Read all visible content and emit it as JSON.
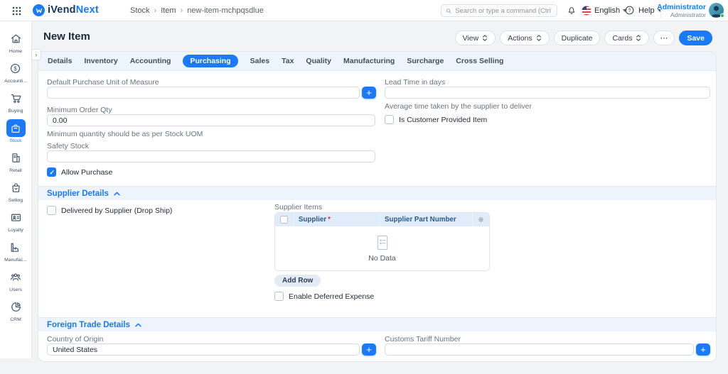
{
  "brand": {
    "name_primary": "iVend",
    "name_accent": "Next"
  },
  "navbar": {
    "breadcrumb": [
      {
        "label": "Stock"
      },
      {
        "label": "Item"
      },
      {
        "label": "new-item-mchpqsdlue"
      }
    ],
    "separator": "›",
    "search_placeholder": "Search or type a command (Ctrl + G)",
    "language": "English",
    "help_label": "Help",
    "user_name": "Administrator",
    "user_role": "Administrator"
  },
  "sidebar": {
    "items": [
      {
        "label": "Home",
        "active": false
      },
      {
        "label": "Accounti...",
        "active": false
      },
      {
        "label": "Buying",
        "active": false
      },
      {
        "label": "Stock",
        "active": true
      },
      {
        "label": "Retail",
        "active": false
      },
      {
        "label": "Selling",
        "active": false
      },
      {
        "label": "Loyalty",
        "active": false
      },
      {
        "label": "Manufac...",
        "active": false
      },
      {
        "label": "Users",
        "active": false
      },
      {
        "label": "CRM",
        "active": false
      }
    ]
  },
  "page": {
    "title": "New Item"
  },
  "toolbar": {
    "view": "View",
    "actions": "Actions",
    "duplicate": "Duplicate",
    "cards": "Cards",
    "more": "⋯",
    "save": "Save"
  },
  "icons": {
    "plus": "+",
    "expand": "›"
  },
  "tabs": [
    {
      "label": "Details",
      "active": false
    },
    {
      "label": "Inventory",
      "active": false
    },
    {
      "label": "Accounting",
      "active": false
    },
    {
      "label": "Purchasing",
      "active": true
    },
    {
      "label": "Sales",
      "active": false
    },
    {
      "label": "Tax",
      "active": false
    },
    {
      "label": "Quality",
      "active": false
    },
    {
      "label": "Manufacturing",
      "active": false
    },
    {
      "label": "Surcharge",
      "active": false
    },
    {
      "label": "Cross Selling",
      "active": false
    }
  ],
  "purchasing": {
    "default_purchase_uom": {
      "label": "Default Purchase Unit of Measure",
      "value": ""
    },
    "lead_time": {
      "label": "Lead Time in days",
      "value": "",
      "help": "Average time taken by the supplier to deliver"
    },
    "min_order_qty": {
      "label": "Minimum Order Qty",
      "value": "0.00",
      "help": "Minimum quantity should be as per Stock UOM"
    },
    "is_customer_provided": {
      "label": "Is Customer Provided Item",
      "checked": false
    },
    "safety_stock": {
      "label": "Safety Stock",
      "value": ""
    },
    "allow_purchase": {
      "label": "Allow Purchase",
      "checked": true
    }
  },
  "supplier_details": {
    "title": "Supplier Details",
    "drop_ship": {
      "label": "Delivered by Supplier (Drop Ship)",
      "checked": false
    },
    "supplier_items": {
      "label": "Supplier Items",
      "columns": [
        {
          "label": "Supplier",
          "required": true
        },
        {
          "label": "Supplier Part Number",
          "required": false
        }
      ],
      "required_marker": "*",
      "empty_text": "No Data",
      "add_row_label": "Add Row"
    },
    "deferred_expense": {
      "label": "Enable Deferred Expense",
      "checked": false
    }
  },
  "foreign_trade": {
    "title": "Foreign Trade Details",
    "country_of_origin": {
      "label": "Country of Origin",
      "value": "United States"
    },
    "customs_tariff_number": {
      "label": "Customs Tariff Number",
      "value": ""
    }
  },
  "colors": {
    "primary": "#1a7af8",
    "section_band": "#edf4fb",
    "table_header_bg": "#e0ecf9",
    "page_background": "#f1f3f5"
  }
}
